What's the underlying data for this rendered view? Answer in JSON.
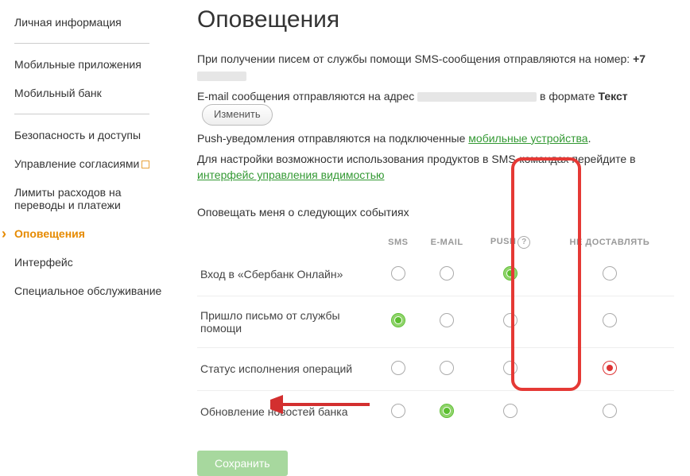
{
  "sidebar": {
    "items": [
      {
        "label": "Личная информация"
      },
      {
        "label": "Мобильные приложения"
      },
      {
        "label": "Мобильный банк"
      },
      {
        "label": "Безопасность и доступы"
      },
      {
        "label": "Управление согласиями"
      },
      {
        "label": "Лимиты расходов на переводы и платежи"
      },
      {
        "label": "Оповещения"
      },
      {
        "label": "Интерфейс"
      },
      {
        "label": "Специальное обслуживание"
      }
    ]
  },
  "main": {
    "title": "Оповещения",
    "info_line1_a": "При получении писем от службы помощи SMS-сообщения отправляются на номер: ",
    "info_line1_phone": "+7",
    "info_line2_a": "E-mail сообщения отправляются на адрес ",
    "info_line2_b": " в формате ",
    "info_line2_fmt": "Текст",
    "btn_change": "Изменить",
    "info_line3_a": "Push-уведомления отправляются на подключенные ",
    "info_line3_link": "мобильные устройства",
    "info_line4_a": "Для настройки возможности использования продуктов в SMS-командах перейдите в ",
    "info_line4_link": "интерфейс управления видимостью",
    "section_title": "Оповещать меня о следующих событиях",
    "columns": {
      "c1": "SMS",
      "c2": "E-MAIL",
      "c3": "PUSH",
      "c4": "НЕ ДОСТАВЛЯТЬ"
    },
    "rows": [
      {
        "label": "Вход в «Сбербанк Онлайн»",
        "sel": "push"
      },
      {
        "label": "Пришло письмо от службы помощи",
        "sel": "sms"
      },
      {
        "label": "Статус исполнения операций",
        "sel": "none"
      },
      {
        "label": "Обновление новостей банка",
        "sel": "email"
      }
    ],
    "btn_save": "Сохранить"
  }
}
